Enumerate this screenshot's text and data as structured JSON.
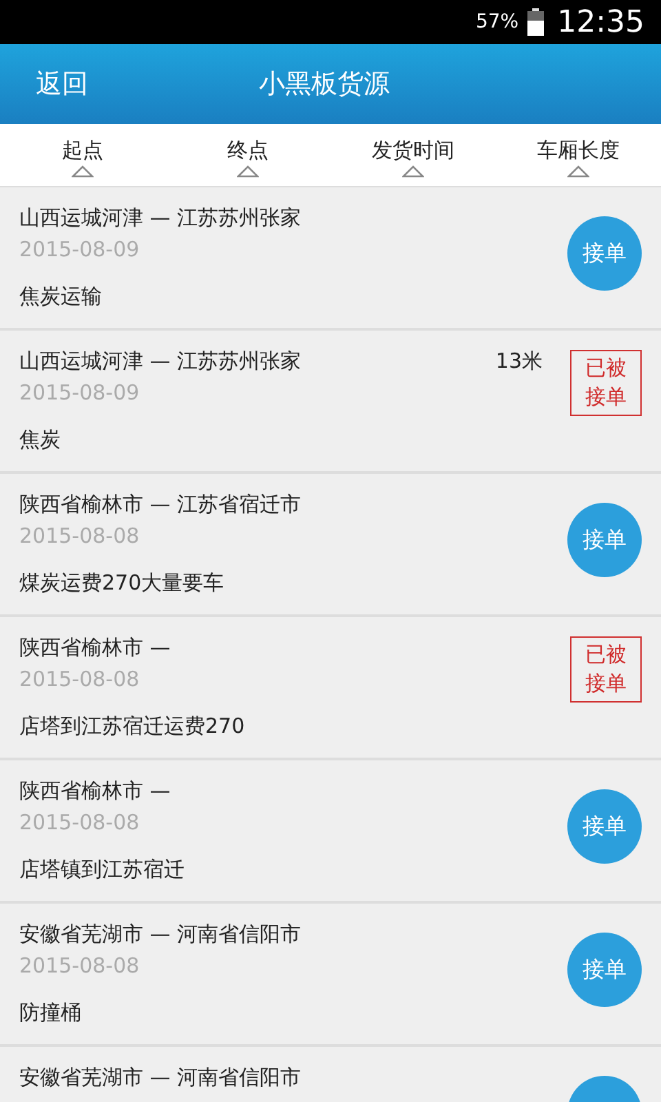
{
  "status_bar": {
    "battery": "57%",
    "time": "12:35"
  },
  "header": {
    "back": "返回",
    "title": "小黑板货源"
  },
  "sort_tabs": [
    {
      "label": "起点"
    },
    {
      "label": "终点"
    },
    {
      "label": "发货时间"
    },
    {
      "label": "车厢长度"
    }
  ],
  "orders": [
    {
      "route": "山西运城河津 — 江苏苏州张家",
      "date": "2015-08-09",
      "description": "焦炭运输",
      "kind": "open",
      "action": "接单"
    },
    {
      "route": "山西运城河津 — 江苏苏州张家",
      "length": "13米",
      "date": "2015-08-09",
      "description": "焦炭",
      "kind": "taken",
      "action": "已被接单"
    },
    {
      "route": "陕西省榆林市 — 江苏省宿迁市",
      "date": "2015-08-08",
      "description": "煤炭运费270大量要车",
      "kind": "open",
      "action": "接单"
    },
    {
      "route": "陕西省榆林市 —",
      "date": "2015-08-08",
      "description": "店塔到江苏宿迁运费270",
      "kind": "taken",
      "action": "已被接单"
    },
    {
      "route": "陕西省榆林市 —",
      "date": "2015-08-08",
      "description": "店塔镇到江苏宿迁",
      "kind": "open",
      "action": "接单"
    },
    {
      "route": "安徽省芜湖市 — 河南省信阳市",
      "date": "2015-08-08",
      "description": "防撞桶",
      "kind": "open",
      "action": "接单"
    },
    {
      "route": "安徽省芜湖市 — 河南省信阳市",
      "kind": "open"
    }
  ]
}
